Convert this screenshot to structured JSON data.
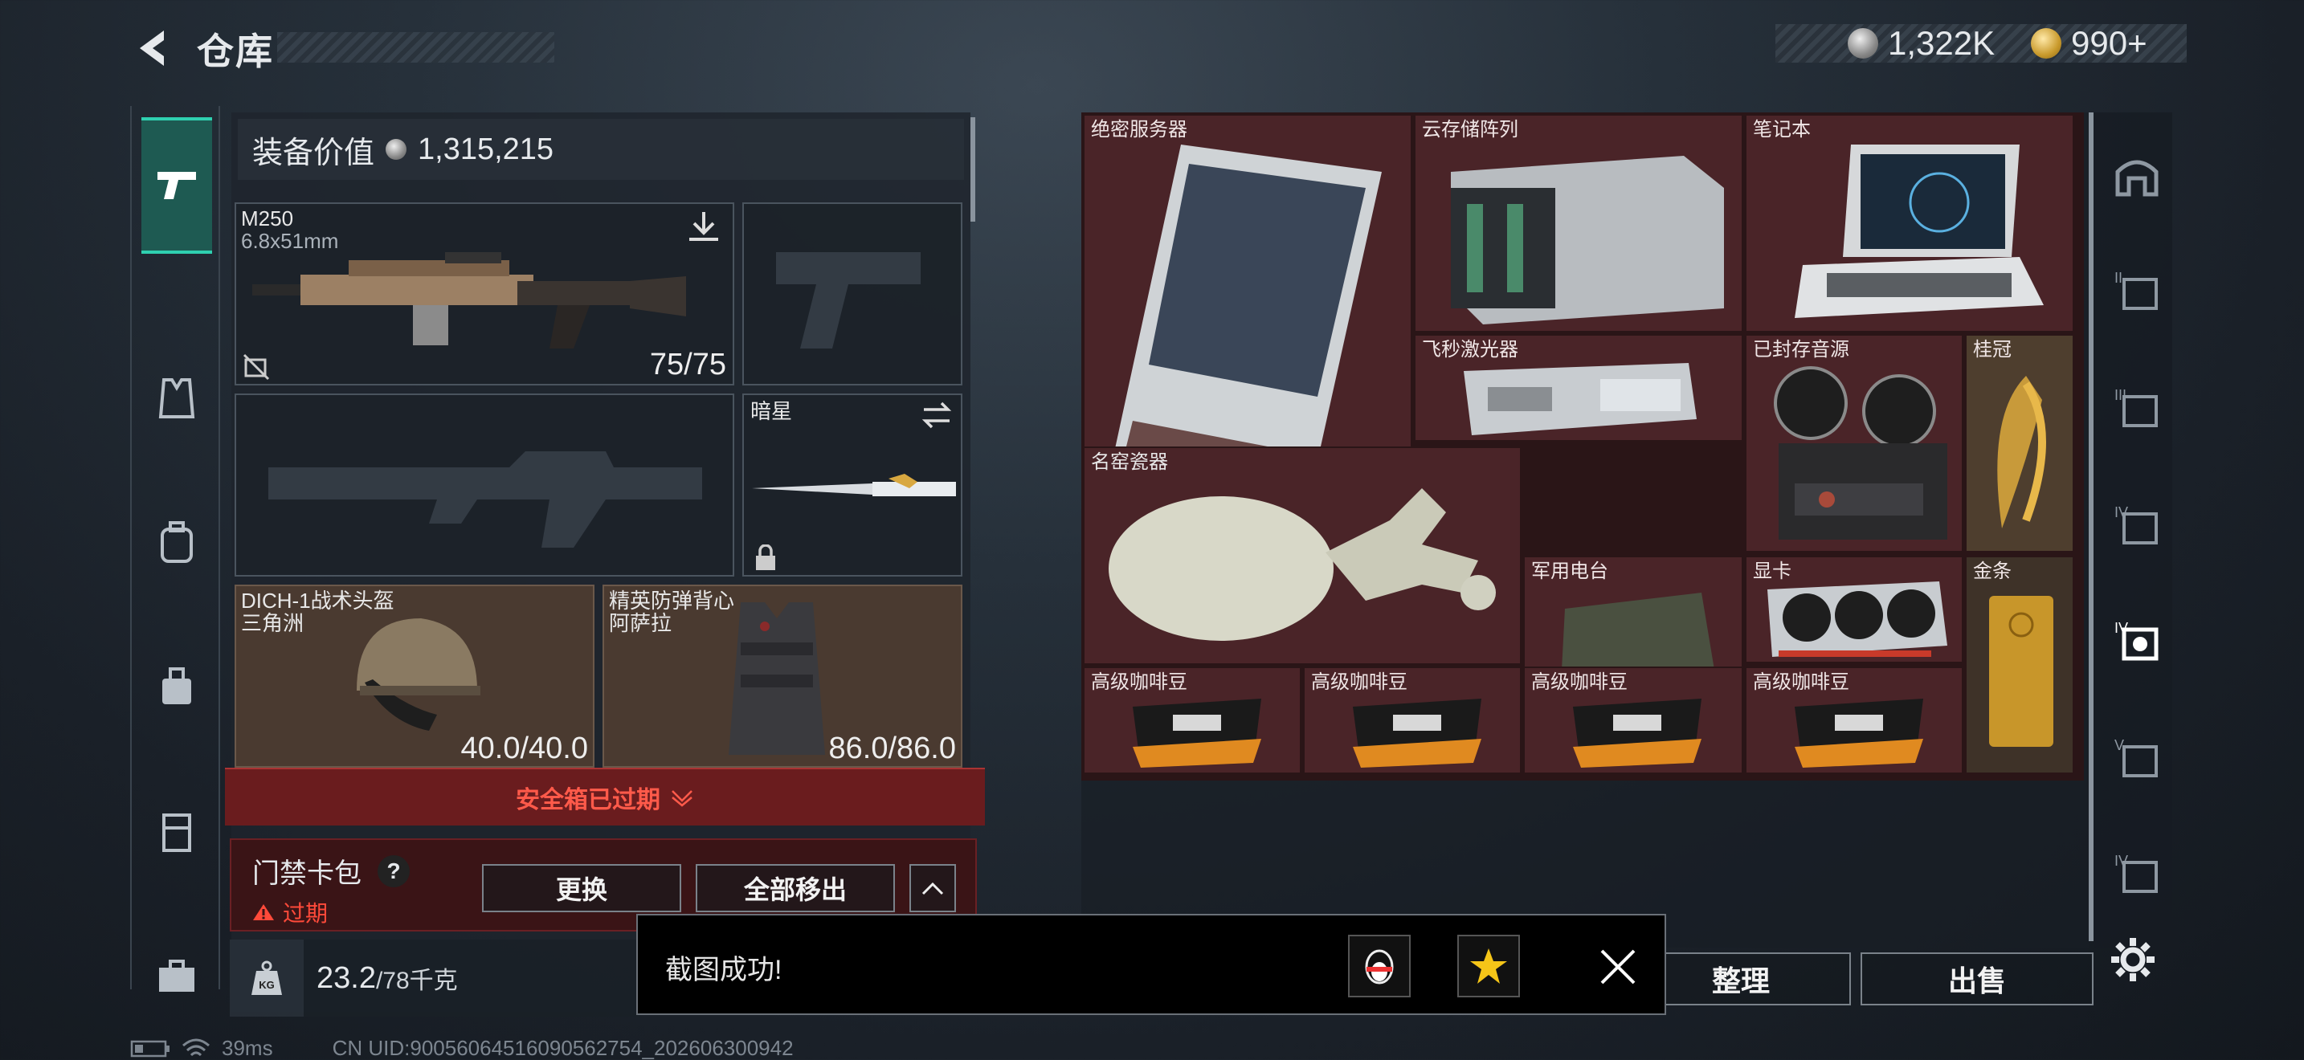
{
  "header": {
    "title": "仓库"
  },
  "currency": {
    "silver": "1,322K",
    "gold": "990+"
  },
  "equipment": {
    "value_label": "装备价值",
    "value": "1,315,215",
    "primary": {
      "name": "M250",
      "ammo": "6.8x51mm",
      "durability": "75/75"
    },
    "melee": {
      "name": "暗星"
    },
    "helmet": {
      "name": "DICH-1战术头盔",
      "map": "三角洲",
      "durability": "40.0/40.0"
    },
    "armor": {
      "name": "精英防弹背心",
      "map": "阿萨拉",
      "durability": "86.0/86.0"
    },
    "safebox_status": "安全箱已过期",
    "keycard": {
      "name": "门禁卡包",
      "help": "?",
      "status": "过期",
      "replace": "更换",
      "remove_all": "全部移出"
    },
    "weight": {
      "value": "23.2",
      "max": "/78千克"
    }
  },
  "stash": {
    "items": [
      {
        "name": "绝密服务器"
      },
      {
        "name": "云存储阵列"
      },
      {
        "name": "笔记本"
      },
      {
        "name": "飞秒激光器"
      },
      {
        "name": "已封存音源"
      },
      {
        "name": "桂冠"
      },
      {
        "name": "名窑瓷器"
      },
      {
        "name": "军用电台"
      },
      {
        "name": "显卡"
      },
      {
        "name": "金条"
      },
      {
        "name": "高级咖啡豆"
      },
      {
        "name": "高级咖啡豆"
      },
      {
        "name": "高级咖啡豆"
      },
      {
        "name": "高级咖啡豆"
      }
    ],
    "sort": "整理",
    "sell": "出售"
  },
  "toast": {
    "message": "截图成功!"
  },
  "status": {
    "ping": "39ms",
    "uid": "CN UID:90056064516090562754_202606300942"
  },
  "colors": {
    "accent": "#2fd0b0",
    "item_bg": "#4a2428",
    "warn": "#e24a3a"
  }
}
